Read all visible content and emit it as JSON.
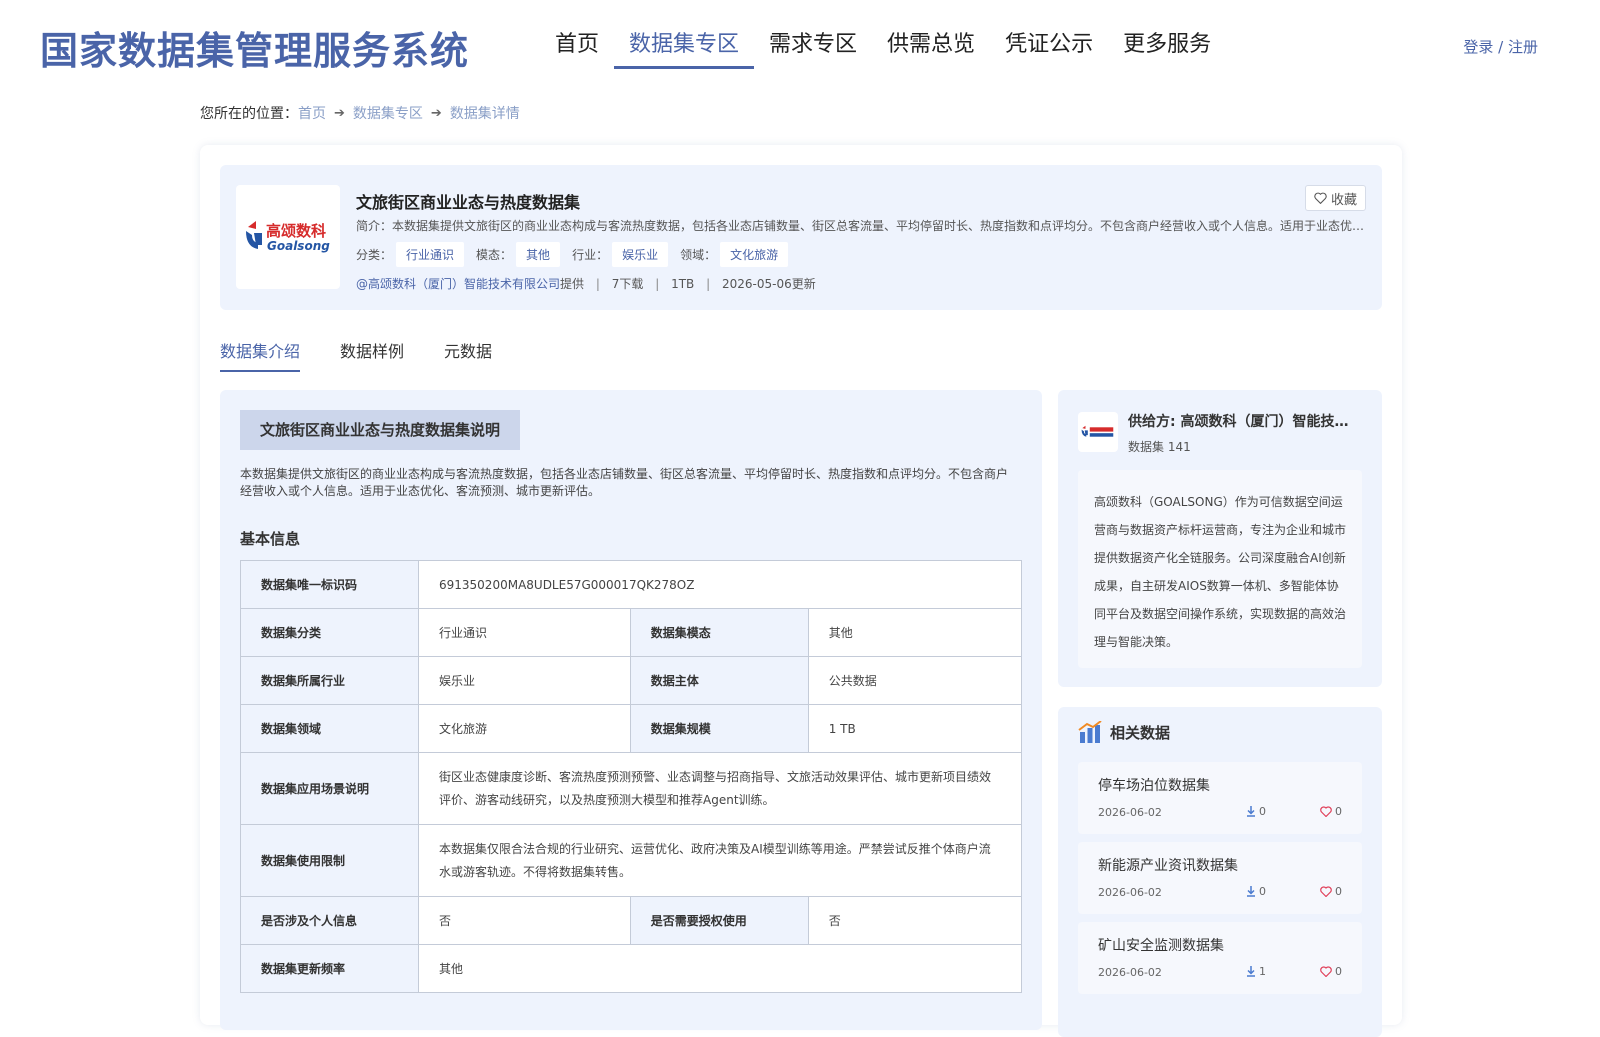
{
  "header": {
    "site_title": "国家数据集管理服务系统",
    "nav": [
      "首页",
      "数据集专区",
      "需求专区",
      "供需总览",
      "凭证公示",
      "更多服务"
    ],
    "login": "登录 / 注册"
  },
  "breadcrumb": {
    "prefix": "您所在的位置：",
    "items": [
      "首页",
      "数据集专区",
      "数据集详情"
    ]
  },
  "dataset": {
    "title": "文旅街区商业业态与热度数据集",
    "summary": "简介：本数据集提供文旅街区的商业业态构成与客流热度数据，包括各业态店铺数量、街区总客流量、平均停留时长、热度指数和点评均分。不包含商户经营收入或个人信息。适用于业态优化、客流预测、城市更新评估。",
    "tags": [
      {
        "label": "分类：",
        "value": "行业通识"
      },
      {
        "label": "模态：",
        "value": "其他"
      },
      {
        "label": "行业：",
        "value": "娱乐业"
      },
      {
        "label": "领域：",
        "value": "文化旅游"
      }
    ],
    "provider": "@高颂数科（厦门）智能技术有限公司",
    "provided": "提供",
    "downloads": "7下载",
    "size": "1TB",
    "updated": "2026-05-06更新",
    "fav": "收藏",
    "logo_cn": "高颂数科",
    "logo_en": "Goalsong"
  },
  "tabs": [
    "数据集介绍",
    "数据样例",
    "元数据"
  ],
  "intro": {
    "section_title": "文旅街区商业业态与热度数据集说明",
    "text": "本数据集提供文旅街区的商业业态构成与客流热度数据，包括各业态店铺数量、街区总客流量、平均停留时长、热度指数和点评均分。不包含商户经营收入或个人信息。适用于业态优化、客流预测、城市更新评估。",
    "basic_title": "基本信息"
  },
  "info": {
    "id_label": "数据集唯一标识码",
    "id_value": "691350200MA8UDLE57G000017QK278OZ",
    "cat_label": "数据集分类",
    "cat_value": "行业通识",
    "modal_label": "数据集模态",
    "modal_value": "其他",
    "ind_label": "数据集所属行业",
    "ind_value": "娱乐业",
    "subject_label": "数据主体",
    "subject_value": "公共数据",
    "field_label": "数据集领域",
    "field_value": "文化旅游",
    "scale_label": "数据集规模",
    "scale_value": "1 TB",
    "scene_label": "数据集应用场景说明",
    "scene_value": "街区业态健康度诊断、客流热度预测预警、业态调整与招商指导、文旅活动效果评估、城市更新项目绩效评价、游客动线研究，以及热度预测大模型和推荐Agent训练。",
    "limit_label": "数据集使用限制",
    "limit_value": "本数据集仅限合法合规的行业研究、运营优化、政府决策及AI模型训练等用途。严禁尝试反推个体商户流水或游客轨迹。不得将数据集转售。",
    "personal_label": "是否涉及个人信息",
    "personal_value": "否",
    "auth_label": "是否需要授权使用",
    "auth_value": "否",
    "freq_label": "数据集更新频率",
    "freq_value": "其他"
  },
  "provider_card": {
    "name": "供给方: 高颂数科（厦门）智能技术有限公司",
    "count": "数据集 141",
    "desc": "高颂数科（GOALSONG）作为可信数据空间运营商与数据资产标杆运营商，专注为企业和城市提供数据资产化全链服务。公司深度融合AI创新成果，自主研发AIOS数算一体机、多智能体协同平台及数据空间操作系统，实现数据的高效治理与智能决策。"
  },
  "related": {
    "title": "相关数据",
    "items": [
      {
        "name": "停车场泊位数据集",
        "date": "2026-06-02",
        "downloads": "0",
        "likes": "0"
      },
      {
        "name": "新能源产业资讯数据集",
        "date": "2026-06-02",
        "downloads": "0",
        "likes": "0"
      },
      {
        "name": "矿山安全监测数据集",
        "date": "2026-06-02",
        "downloads": "1",
        "likes": "0"
      }
    ]
  },
  "colors": {
    "accent": "#4a64a8",
    "panel": "#eef3fd",
    "logo_red": "#d62b2b",
    "logo_blue": "#2455a4"
  }
}
